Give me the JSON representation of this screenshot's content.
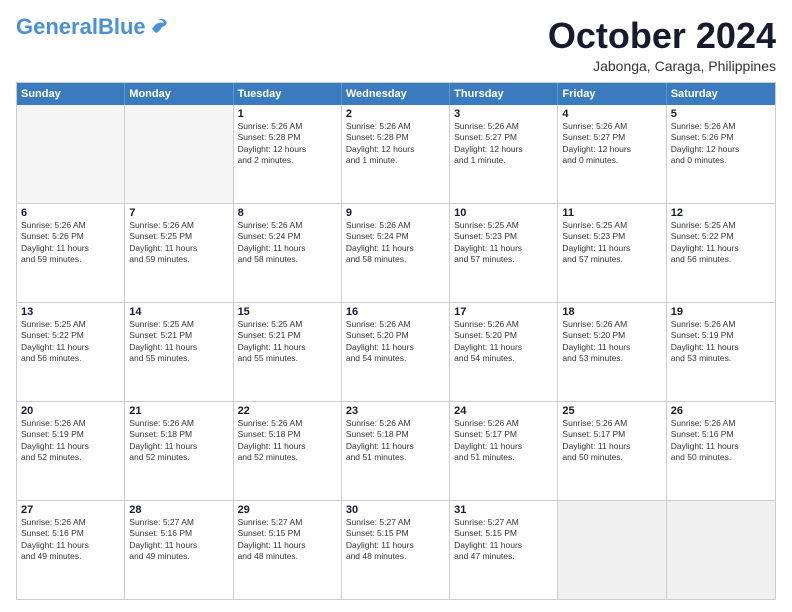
{
  "logo": {
    "general": "General",
    "blue": "Blue"
  },
  "header": {
    "month": "October 2024",
    "location": "Jabonga, Caraga, Philippines"
  },
  "days": [
    "Sunday",
    "Monday",
    "Tuesday",
    "Wednesday",
    "Thursday",
    "Friday",
    "Saturday"
  ],
  "rows": [
    [
      {
        "day": "",
        "lines": [],
        "empty": true
      },
      {
        "day": "",
        "lines": [],
        "empty": true
      },
      {
        "day": "1",
        "lines": [
          "Sunrise: 5:26 AM",
          "Sunset: 5:28 PM",
          "Daylight: 12 hours",
          "and 2 minutes."
        ]
      },
      {
        "day": "2",
        "lines": [
          "Sunrise: 5:26 AM",
          "Sunset: 5:28 PM",
          "Daylight: 12 hours",
          "and 1 minute."
        ]
      },
      {
        "day": "3",
        "lines": [
          "Sunrise: 5:26 AM",
          "Sunset: 5:27 PM",
          "Daylight: 12 hours",
          "and 1 minute."
        ]
      },
      {
        "day": "4",
        "lines": [
          "Sunrise: 5:26 AM",
          "Sunset: 5:27 PM",
          "Daylight: 12 hours",
          "and 0 minutes."
        ]
      },
      {
        "day": "5",
        "lines": [
          "Sunrise: 5:26 AM",
          "Sunset: 5:26 PM",
          "Daylight: 12 hours",
          "and 0 minutes."
        ]
      }
    ],
    [
      {
        "day": "6",
        "lines": [
          "Sunrise: 5:26 AM",
          "Sunset: 5:26 PM",
          "Daylight: 11 hours",
          "and 59 minutes."
        ]
      },
      {
        "day": "7",
        "lines": [
          "Sunrise: 5:26 AM",
          "Sunset: 5:25 PM",
          "Daylight: 11 hours",
          "and 59 minutes."
        ]
      },
      {
        "day": "8",
        "lines": [
          "Sunrise: 5:26 AM",
          "Sunset: 5:24 PM",
          "Daylight: 11 hours",
          "and 58 minutes."
        ]
      },
      {
        "day": "9",
        "lines": [
          "Sunrise: 5:26 AM",
          "Sunset: 5:24 PM",
          "Daylight: 11 hours",
          "and 58 minutes."
        ]
      },
      {
        "day": "10",
        "lines": [
          "Sunrise: 5:25 AM",
          "Sunset: 5:23 PM",
          "Daylight: 11 hours",
          "and 57 minutes."
        ]
      },
      {
        "day": "11",
        "lines": [
          "Sunrise: 5:25 AM",
          "Sunset: 5:23 PM",
          "Daylight: 11 hours",
          "and 57 minutes."
        ]
      },
      {
        "day": "12",
        "lines": [
          "Sunrise: 5:25 AM",
          "Sunset: 5:22 PM",
          "Daylight: 11 hours",
          "and 56 minutes."
        ]
      }
    ],
    [
      {
        "day": "13",
        "lines": [
          "Sunrise: 5:25 AM",
          "Sunset: 5:22 PM",
          "Daylight: 11 hours",
          "and 56 minutes."
        ]
      },
      {
        "day": "14",
        "lines": [
          "Sunrise: 5:25 AM",
          "Sunset: 5:21 PM",
          "Daylight: 11 hours",
          "and 55 minutes."
        ]
      },
      {
        "day": "15",
        "lines": [
          "Sunrise: 5:25 AM",
          "Sunset: 5:21 PM",
          "Daylight: 11 hours",
          "and 55 minutes."
        ]
      },
      {
        "day": "16",
        "lines": [
          "Sunrise: 5:26 AM",
          "Sunset: 5:20 PM",
          "Daylight: 11 hours",
          "and 54 minutes."
        ]
      },
      {
        "day": "17",
        "lines": [
          "Sunrise: 5:26 AM",
          "Sunset: 5:20 PM",
          "Daylight: 11 hours",
          "and 54 minutes."
        ]
      },
      {
        "day": "18",
        "lines": [
          "Sunrise: 5:26 AM",
          "Sunset: 5:20 PM",
          "Daylight: 11 hours",
          "and 53 minutes."
        ]
      },
      {
        "day": "19",
        "lines": [
          "Sunrise: 5:26 AM",
          "Sunset: 5:19 PM",
          "Daylight: 11 hours",
          "and 53 minutes."
        ]
      }
    ],
    [
      {
        "day": "20",
        "lines": [
          "Sunrise: 5:26 AM",
          "Sunset: 5:19 PM",
          "Daylight: 11 hours",
          "and 52 minutes."
        ]
      },
      {
        "day": "21",
        "lines": [
          "Sunrise: 5:26 AM",
          "Sunset: 5:18 PM",
          "Daylight: 11 hours",
          "and 52 minutes."
        ]
      },
      {
        "day": "22",
        "lines": [
          "Sunrise: 5:26 AM",
          "Sunset: 5:18 PM",
          "Daylight: 11 hours",
          "and 52 minutes."
        ]
      },
      {
        "day": "23",
        "lines": [
          "Sunrise: 5:26 AM",
          "Sunset: 5:18 PM",
          "Daylight: 11 hours",
          "and 51 minutes."
        ]
      },
      {
        "day": "24",
        "lines": [
          "Sunrise: 5:26 AM",
          "Sunset: 5:17 PM",
          "Daylight: 11 hours",
          "and 51 minutes."
        ]
      },
      {
        "day": "25",
        "lines": [
          "Sunrise: 5:26 AM",
          "Sunset: 5:17 PM",
          "Daylight: 11 hours",
          "and 50 minutes."
        ]
      },
      {
        "day": "26",
        "lines": [
          "Sunrise: 5:26 AM",
          "Sunset: 5:16 PM",
          "Daylight: 11 hours",
          "and 50 minutes."
        ]
      }
    ],
    [
      {
        "day": "27",
        "lines": [
          "Sunrise: 5:26 AM",
          "Sunset: 5:16 PM",
          "Daylight: 11 hours",
          "and 49 minutes."
        ]
      },
      {
        "day": "28",
        "lines": [
          "Sunrise: 5:27 AM",
          "Sunset: 5:16 PM",
          "Daylight: 11 hours",
          "and 49 minutes."
        ]
      },
      {
        "day": "29",
        "lines": [
          "Sunrise: 5:27 AM",
          "Sunset: 5:15 PM",
          "Daylight: 11 hours",
          "and 48 minutes."
        ]
      },
      {
        "day": "30",
        "lines": [
          "Sunrise: 5:27 AM",
          "Sunset: 5:15 PM",
          "Daylight: 11 hours",
          "and 48 minutes."
        ]
      },
      {
        "day": "31",
        "lines": [
          "Sunrise: 5:27 AM",
          "Sunset: 5:15 PM",
          "Daylight: 11 hours",
          "and 47 minutes."
        ]
      },
      {
        "day": "",
        "lines": [],
        "empty": true,
        "shaded": true
      },
      {
        "day": "",
        "lines": [],
        "empty": true,
        "shaded": true
      }
    ]
  ]
}
